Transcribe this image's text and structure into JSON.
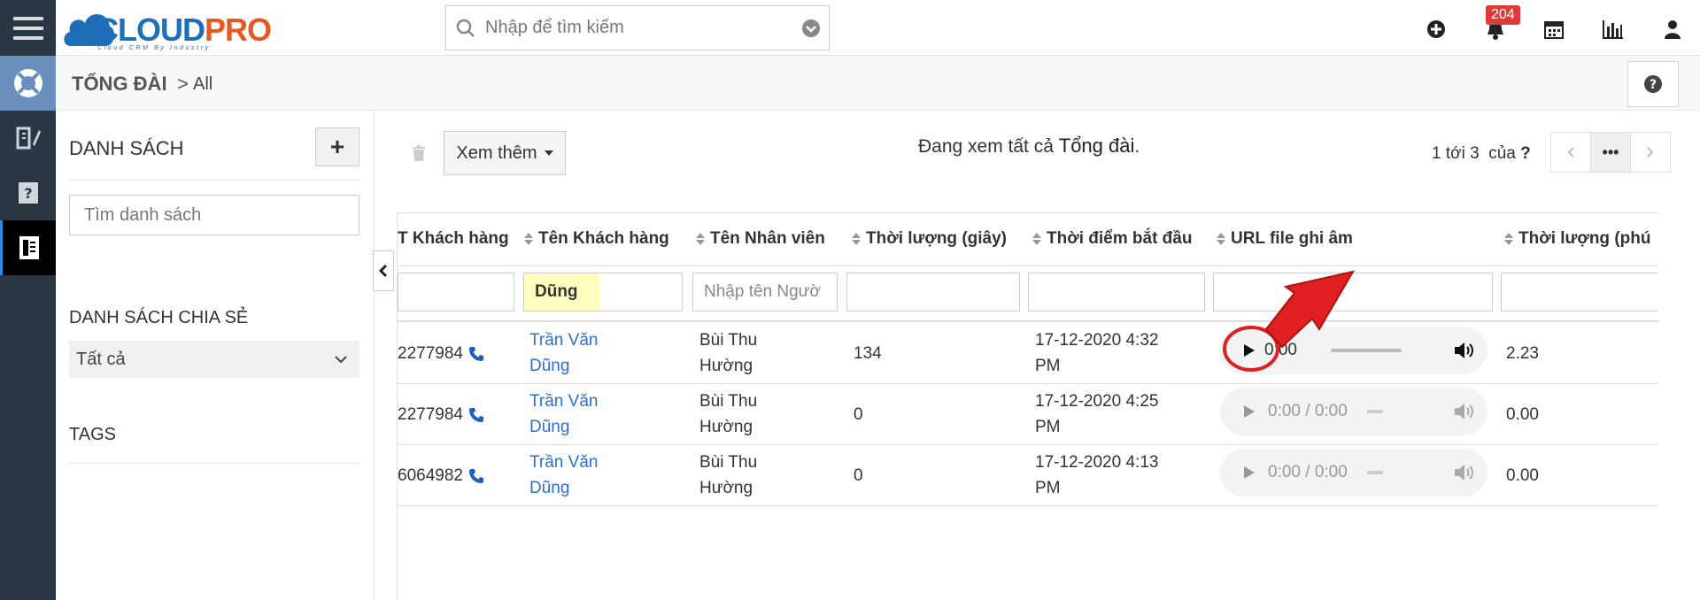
{
  "header": {
    "logo_text_1": "CLOUD",
    "logo_text_2": "PRO",
    "logo_tagline": "Cloud CRM By Industry",
    "search_placeholder": "Nhập để tìm kiếm",
    "notification_count": "204",
    "icons": [
      "plus-circle-icon",
      "bell-icon",
      "calendar-icon",
      "chart-icon",
      "user-icon"
    ]
  },
  "breadcrumb": {
    "module": "TỔNG ĐÀI",
    "separator": ">",
    "current": "All"
  },
  "sidebar_rail": [
    "support-icon",
    "book-edit-icon",
    "help-book-icon",
    "phone-book-icon"
  ],
  "list_panel": {
    "title": "DANH SÁCH",
    "add_label": "+",
    "search_placeholder": "Tìm danh sách",
    "shared_title": "DANH SÁCH CHIA SẺ",
    "shared_select": "Tất cả",
    "tags_title": "TAGS"
  },
  "toolbar": {
    "more_label": "Xem thêm",
    "viewing_prefix": "Đang xem tất cả",
    "viewing_module": "Tổng đài",
    "viewing_suffix": ".",
    "pager_range": "1 tới 3",
    "pager_of": "của",
    "pager_total": "?",
    "pager_more": "•••"
  },
  "table": {
    "columns": [
      "T Khách hàng",
      "Tên Khách hàng",
      "Tên Nhân viên",
      "Thời lượng (giây)",
      "Thời điểm bắt đầu",
      "URL file ghi âm",
      "Thời lượng (phú"
    ],
    "filters": {
      "customer_name": "Dũng",
      "employee_placeholder": "Nhập tên Ngườ"
    },
    "rows": [
      {
        "phone": "2277984",
        "customer": "Trần Văn Dũng",
        "customer_l1": "Trần Văn",
        "customer_l2": "Dũng",
        "employee_l1": "Bùi Thu",
        "employee_l2": "Hường",
        "duration": "134",
        "start_l1": "17-12-2020 4:32",
        "start_l2": "PM",
        "audio_time": "0:00",
        "minutes": "2.23"
      },
      {
        "phone": "2277984",
        "customer": "Trần Văn Dũng",
        "customer_l1": "Trần Văn",
        "customer_l2": "Dũng",
        "employee_l1": "Bùi Thu",
        "employee_l2": "Hường",
        "duration": "0",
        "start_l1": "17-12-2020 4:25",
        "start_l2": "PM",
        "audio_time": "0:00 / 0:00",
        "minutes": "0.00"
      },
      {
        "phone": "6064982",
        "customer": "Trần Văn Dũng",
        "customer_l1": "Trần Văn",
        "customer_l2": "Dũng",
        "employee_l1": "Bùi Thu",
        "employee_l2": "Hường",
        "duration": "0",
        "start_l1": "17-12-2020 4:13",
        "start_l2": "PM",
        "audio_time": "0:00 / 0:00",
        "minutes": "0.00"
      }
    ]
  },
  "colors": {
    "rail_bg": "#2b3643",
    "rail_active_bg": "#6a8fbf",
    "link": "#2b6fd1",
    "badge": "#e03a3a",
    "annotation": "#e02020"
  }
}
